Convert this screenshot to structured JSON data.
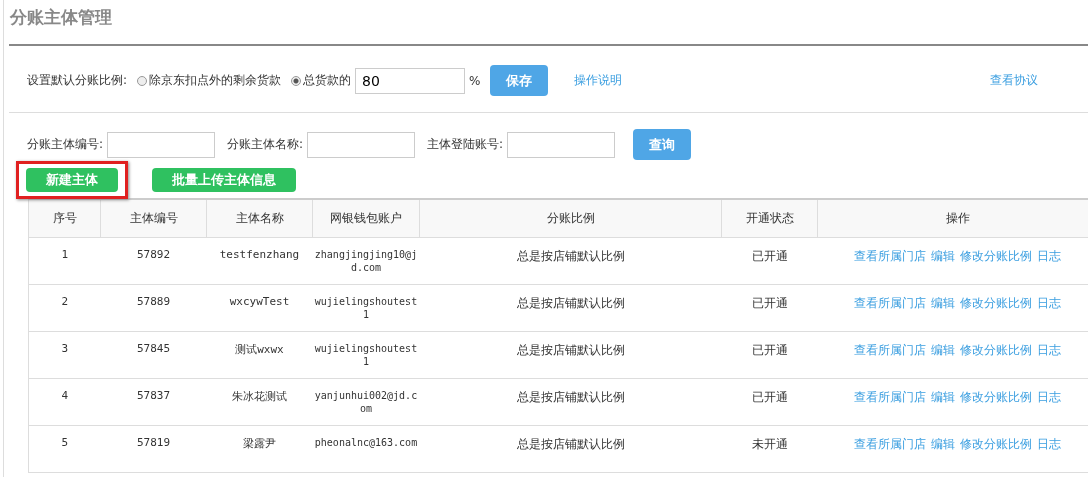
{
  "page_title": "分账主体管理",
  "settings": {
    "label": "设置默认分账比例:",
    "options": [
      {
        "label": "除京东扣点外的剩余货款",
        "selected": false
      },
      {
        "label": "总货款的",
        "selected": true
      }
    ],
    "percent_value": "80",
    "percent_sign": "%",
    "save_button": "保存",
    "help_link": "操作说明",
    "agreement_link": "查看协议"
  },
  "search": {
    "fields": [
      {
        "label": "分账主体编号:"
      },
      {
        "label": "分账主体名称:"
      },
      {
        "label": "主体登陆账号:"
      }
    ],
    "button": "查询"
  },
  "actions": [
    {
      "label": "新建主体",
      "highlighted": true
    },
    {
      "label": "批量上传主体信息",
      "highlighted": false
    }
  ],
  "table": {
    "columns": [
      "序号",
      "主体编号",
      "主体名称",
      "网银钱包账户",
      "分账比例",
      "开通状态",
      "操作"
    ],
    "rows": [
      {
        "index": "1",
        "id": "57892",
        "name": "testfenzhang",
        "account": "zhangjingjing10@jd.com",
        "ratio": "总是按店铺默认比例",
        "status": "已开通",
        "links": [
          "查看所属门店",
          "编辑",
          "修改分账比例",
          "日志"
        ]
      },
      {
        "index": "2",
        "id": "57889",
        "name": "wxcywTest",
        "account": "wujielingshoutest1",
        "ratio": "总是按店铺默认比例",
        "status": "已开通",
        "links": [
          "查看所属门店",
          "编辑",
          "修改分账比例",
          "日志"
        ]
      },
      {
        "index": "3",
        "id": "57845",
        "name": "测试wxwx",
        "account": "wujielingshoutest1",
        "ratio": "总是按店铺默认比例",
        "status": "已开通",
        "links": [
          "查看所属门店",
          "编辑",
          "修改分账比例",
          "日志"
        ]
      },
      {
        "index": "4",
        "id": "57837",
        "name": "朱冰花测试",
        "account": "yanjunhui002@jd.com",
        "ratio": "总是按店铺默认比例",
        "status": "已开通",
        "links": [
          "查看所属门店",
          "编辑",
          "修改分账比例",
          "日志"
        ]
      },
      {
        "index": "5",
        "id": "57819",
        "name": "梁露尹",
        "account": "pheonalnc@163.com",
        "ratio": "总是按店铺默认比例",
        "status": "未开通",
        "links": [
          "查看所属门店",
          "编辑",
          "修改分账比例",
          "日志"
        ]
      }
    ]
  }
}
